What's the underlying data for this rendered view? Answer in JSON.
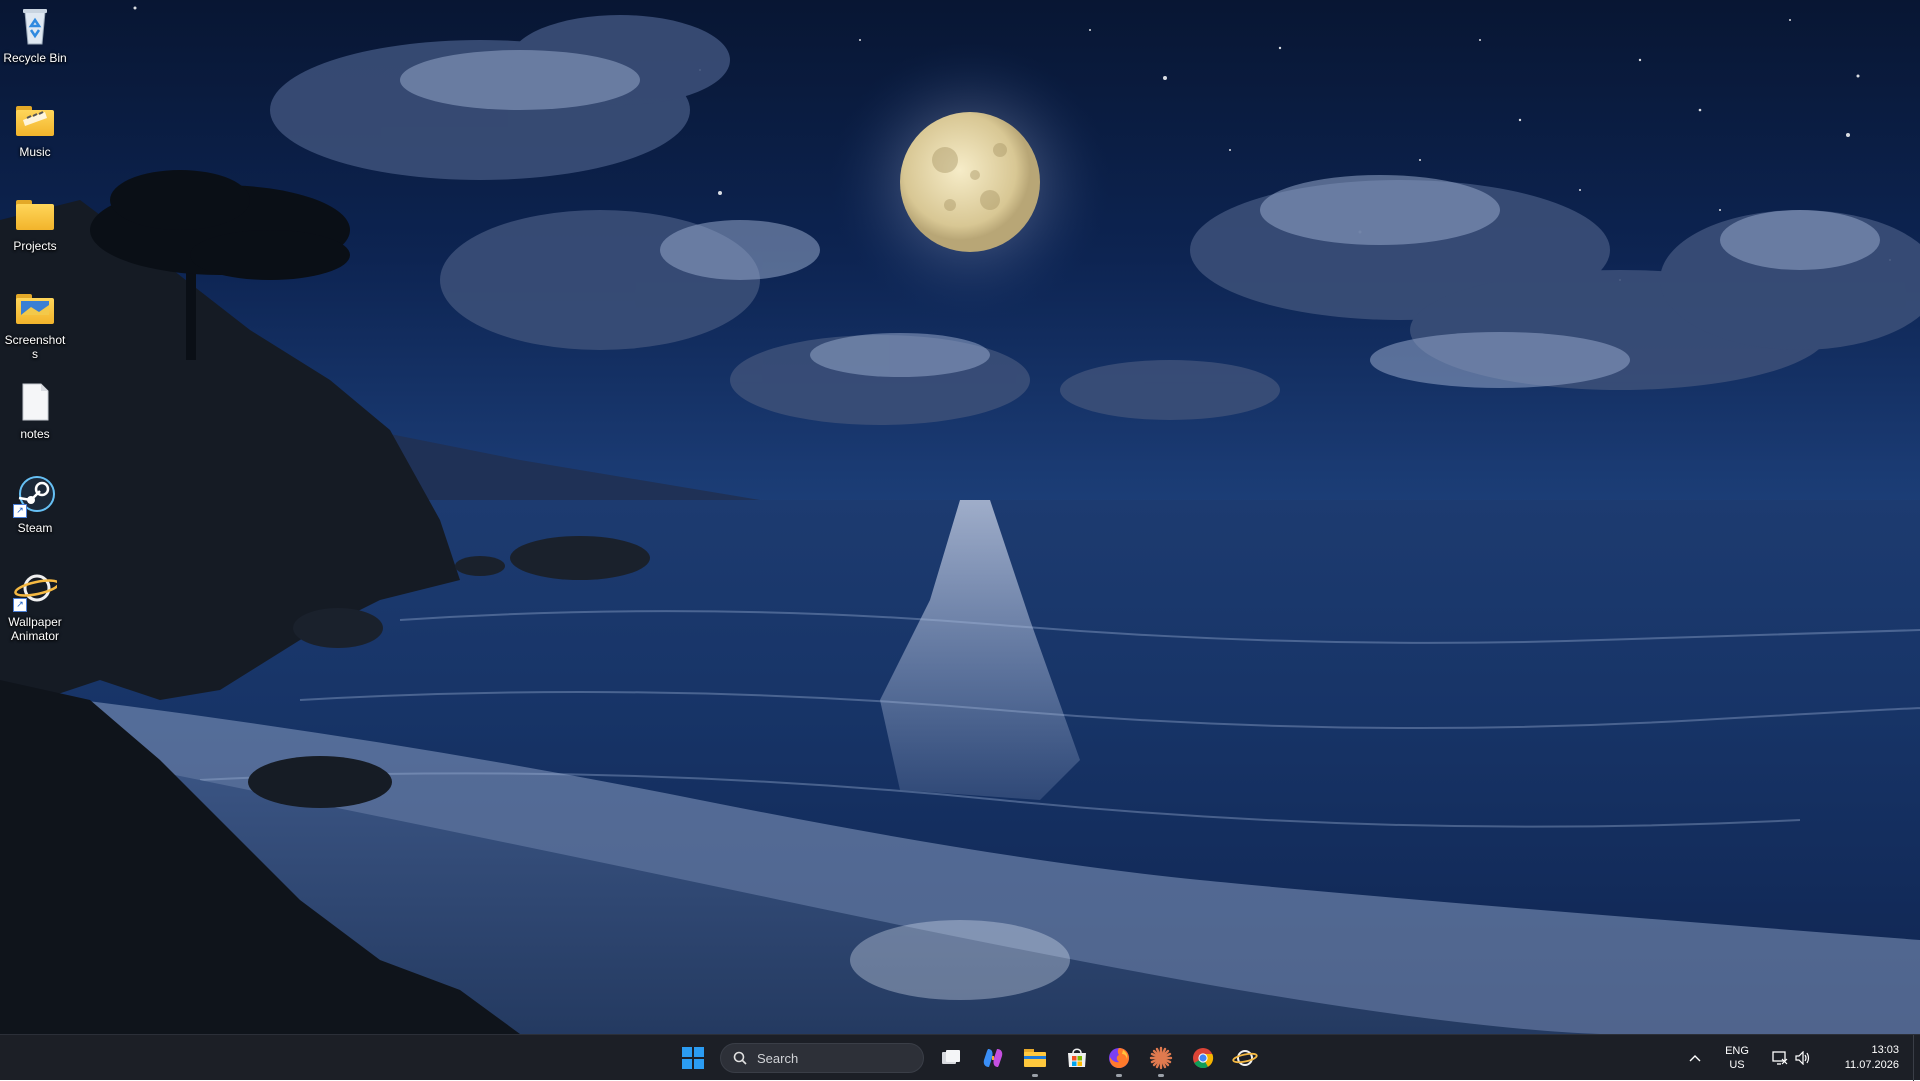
{
  "desktop": {
    "icons": [
      {
        "label": "Recycle Bin",
        "icon": "recycle-bin-icon",
        "shortcut": false
      },
      {
        "label": "Music",
        "icon": "folder-icon",
        "shortcut": false
      },
      {
        "label": "Projects",
        "icon": "folder-icon",
        "shortcut": false
      },
      {
        "label": "Screenshots",
        "icon": "folder-icon",
        "shortcut": false
      },
      {
        "label": "notes",
        "icon": "text-file-icon",
        "shortcut": false
      },
      {
        "label": "Steam",
        "icon": "steam-icon",
        "shortcut": true
      },
      {
        "label": "Wallpaper Animator",
        "icon": "wallpaper-animator-icon",
        "shortcut": true
      }
    ]
  },
  "taskbar": {
    "search": {
      "placeholder": "Search"
    },
    "apps": [
      {
        "name": "start",
        "icon": "windows-start-icon"
      },
      {
        "name": "task-view",
        "icon": "task-view-icon"
      },
      {
        "name": "copilot",
        "icon": "copilot-icon"
      },
      {
        "name": "file-explorer",
        "icon": "folder-icon",
        "running": true
      },
      {
        "name": "microsoft-store",
        "icon": "store-icon"
      },
      {
        "name": "firefox",
        "icon": "firefox-icon",
        "running": true
      },
      {
        "name": "claude",
        "icon": "starburst-icon",
        "running": true
      },
      {
        "name": "chrome",
        "icon": "chrome-icon"
      },
      {
        "name": "wallpaper-animator",
        "icon": "wallpaper-animator-icon",
        "active": true
      }
    ],
    "tray": {
      "lang_line1": "ENG",
      "lang_line2": "US",
      "time": "13:03",
      "date": "11.07.2026"
    }
  },
  "colors": {
    "taskbar_bg": "#1c1f26",
    "active_indicator": "#4cc2ff",
    "folder_yellow": "#f2b42b",
    "windows_blue": "#0f7bd8"
  }
}
